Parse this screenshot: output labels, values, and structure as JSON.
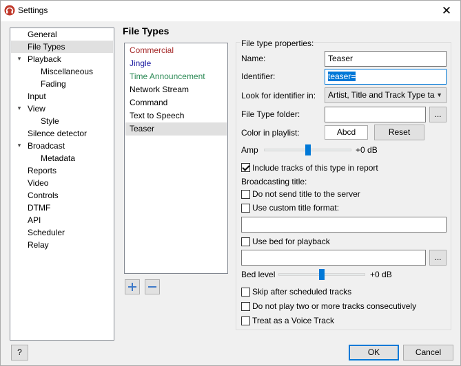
{
  "window": {
    "title": "Settings",
    "close_glyph": "✕",
    "app_icon": "headphones-icon"
  },
  "nav": {
    "items": [
      {
        "label": "General",
        "level": 0
      },
      {
        "label": "File Types",
        "level": 0,
        "selected": true
      },
      {
        "label": "Playback",
        "level": 0,
        "expanded": true
      },
      {
        "label": "Miscellaneous",
        "level": 1
      },
      {
        "label": "Fading",
        "level": 1
      },
      {
        "label": "Input",
        "level": 0
      },
      {
        "label": "View",
        "level": 0,
        "expanded": true
      },
      {
        "label": "Style",
        "level": 1
      },
      {
        "label": "Silence detector",
        "level": 0
      },
      {
        "label": "Broadcast",
        "level": 0,
        "expanded": true
      },
      {
        "label": "Metadata",
        "level": 1
      },
      {
        "label": "Reports",
        "level": 0
      },
      {
        "label": "Video",
        "level": 0
      },
      {
        "label": "Controls",
        "level": 0
      },
      {
        "label": "DTMF",
        "level": 0
      },
      {
        "label": "API",
        "level": 0
      },
      {
        "label": "Scheduler",
        "level": 0
      },
      {
        "label": "Relay",
        "level": 0
      }
    ]
  },
  "page": {
    "heading": "File Types"
  },
  "file_types": {
    "items": [
      {
        "label": "Commercial",
        "color": "#a52a2a"
      },
      {
        "label": "Jingle",
        "color": "#1a1aa0"
      },
      {
        "label": "Time Announcement",
        "color": "#2e8b57"
      },
      {
        "label": "Network Stream",
        "color": "#000000"
      },
      {
        "label": "Command",
        "color": "#000000"
      },
      {
        "label": "Text to Speech",
        "color": "#000000"
      },
      {
        "label": "Teaser",
        "color": "#000000",
        "selected": true
      }
    ]
  },
  "props": {
    "group_title": "File type properties:",
    "name_label": "Name:",
    "name_value": "Teaser",
    "identifier_label": "Identifier:",
    "identifier_value": "teaser=",
    "look_label": "Look for identifier in:",
    "look_value": "Artist, Title and Track Type ta",
    "folder_label": "File Type folder:",
    "folder_value": "",
    "browse_label": "...",
    "color_label": "Color in playlist:",
    "color_swatch_text": "Abcd",
    "reset_label": "Reset",
    "amp_label": "Amp",
    "amp_value": "+0 dB",
    "amp_fraction": 0.5,
    "include_label": "Include tracks of this type in report",
    "include_checked": true,
    "broadcasting_title_label": "Broadcasting title:",
    "do_not_send_label": "Do not send title to the server",
    "custom_format_label": "Use custom title format:",
    "custom_format_value": "",
    "use_bed_label": "Use bed for playback",
    "bed_value": "",
    "bed_level_label": "Bed level",
    "bed_level_value": "+0 dB",
    "bed_level_fraction": 0.5,
    "skip_label": "Skip after scheduled tracks",
    "no_two_label": "Do not play two or more tracks consecutively",
    "voice_track_label": "Treat as a Voice Track"
  },
  "footer": {
    "help_label": "?",
    "ok_label": "OK",
    "cancel_label": "Cancel"
  }
}
